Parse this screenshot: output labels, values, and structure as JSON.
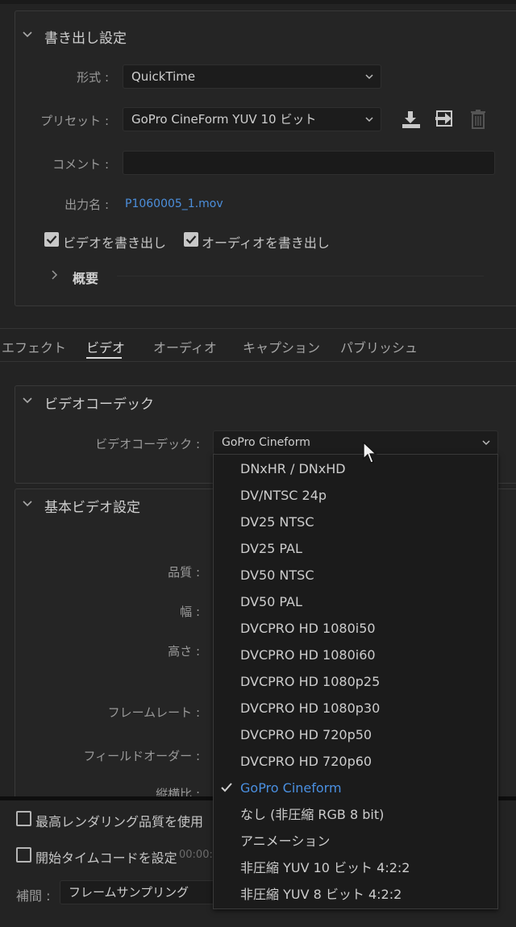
{
  "export_settings": {
    "title": "書き出し設定",
    "format_label": "形式 :",
    "format_value": "QuickTime",
    "preset_label": "プリセット :",
    "preset_value": "GoPro CineForm YUV 10 ビット",
    "comment_label": "コメント :",
    "comment_value": "",
    "output_label": "出力名 :",
    "output_value": "P1060005_1.mov",
    "export_video_label": "ビデオを書き出し",
    "export_audio_label": "オーディオを書き出し",
    "summary_label": "概要"
  },
  "tabs": [
    {
      "label": "エフェクト"
    },
    {
      "label": "ビデオ"
    },
    {
      "label": "オーディオ"
    },
    {
      "label": "キャプション"
    },
    {
      "label": "パブリッシュ"
    }
  ],
  "video_codec": {
    "title": "ビデオコーデック",
    "codec_label": "ビデオコーデック :",
    "codec_value": "GoPro Cineform"
  },
  "basic_video": {
    "title": "基本ビデオ設定",
    "quality_label": "品質 :",
    "width_label": "幅 :",
    "height_label": "高さ :",
    "framerate_label": "フレームレート :",
    "field_order_label": "フィールドオーダー :",
    "aspect_label": "縦横比 :"
  },
  "bottom": {
    "max_render_label": "最高レンダリング品質を使用",
    "start_timecode_label": "開始タイムコードを設定",
    "start_timecode_value": "00:00:",
    "interp_label": "補間 :",
    "interp_value": "フレームサンプリング"
  },
  "codec_options": [
    {
      "label": "DNxHR / DNxHD"
    },
    {
      "label": "DV/NTSC 24p"
    },
    {
      "label": "DV25 NTSC"
    },
    {
      "label": "DV25 PAL"
    },
    {
      "label": "DV50 NTSC"
    },
    {
      "label": "DV50 PAL"
    },
    {
      "label": "DVCPRO HD 1080i50"
    },
    {
      "label": "DVCPRO HD 1080i60"
    },
    {
      "label": "DVCPRO HD 1080p25"
    },
    {
      "label": "DVCPRO HD 1080p30"
    },
    {
      "label": "DVCPRO HD 720p50"
    },
    {
      "label": "DVCPRO HD 720p60"
    },
    {
      "label": "GoPro Cineform"
    },
    {
      "label": "なし (非圧縮 RGB 8 bit)"
    },
    {
      "label": "アニメーション"
    },
    {
      "label": "非圧縮 YUV 10 ビット 4:2:2"
    },
    {
      "label": "非圧縮 YUV 8 ビット 4:2:2"
    }
  ],
  "selected_codec_index": 12,
  "icons": [
    "chevron-down-icon",
    "chevron-right-icon",
    "save-preset-icon",
    "import-preset-icon",
    "trash-icon",
    "checkmark-icon",
    "mouse-cursor-icon"
  ],
  "colors": {
    "accent": "#4a8fe0",
    "link": "#4c8fdc",
    "background": "#232323"
  }
}
